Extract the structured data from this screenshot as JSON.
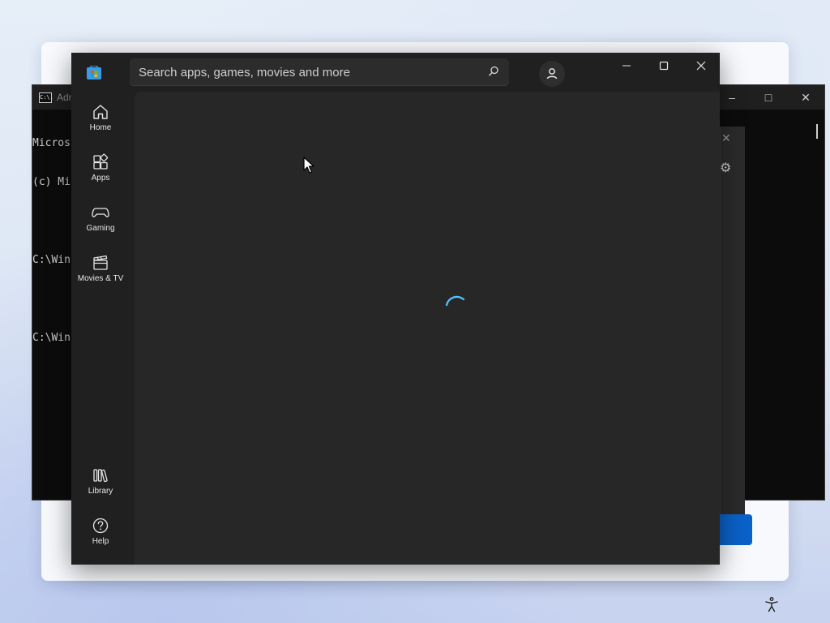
{
  "console": {
    "title": "Adr",
    "icon_text": "C:\\.",
    "lines": [
      "Micros",
      "(c) Mi",
      "",
      "C:\\Win",
      "",
      "C:\\Win"
    ]
  },
  "store": {
    "search_placeholder": "Search apps, games, movies and more",
    "nav": {
      "home": "Home",
      "apps": "Apps",
      "gaming": "Gaming",
      "movies": "Movies & TV",
      "library": "Library",
      "help": "Help"
    },
    "loading": true
  },
  "colors": {
    "accent": "#4cc2ff",
    "window_bg": "#202020",
    "content_bg": "#272727",
    "oobe_button": "#0a62c9"
  }
}
